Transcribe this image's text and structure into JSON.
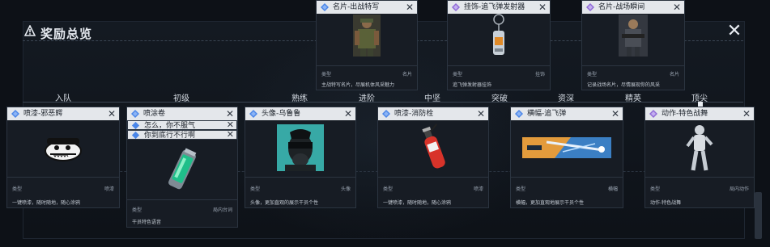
{
  "header": {
    "title": "奖励总览",
    "close_symbol": "✕"
  },
  "levels": [
    {
      "label": "入队"
    },
    {
      "label": "初级"
    },
    {
      "label": "熟练"
    },
    {
      "label": "进阶"
    },
    {
      "label": "中坚"
    },
    {
      "label": "突破"
    },
    {
      "label": "资深"
    },
    {
      "label": "精英"
    },
    {
      "label": "顶尖"
    }
  ],
  "top_cards": [
    {
      "title": "名片-出战特写",
      "type_label": "类型",
      "type_value": "名片",
      "desc": "主战特写名片，尽展机体风采魅力"
    },
    {
      "title": "挂饰-追飞弹发射器",
      "type_label": "类型",
      "type_value": "挂饰",
      "desc": "追飞弹发射器挂饰"
    },
    {
      "title": "名片-战场瞬间",
      "type_label": "类型",
      "type_value": "名片",
      "desc": "记录战场名片，尽情展现你的风采"
    }
  ],
  "bottom_cards": [
    {
      "title": "喷漆-邪恶鳄",
      "type_label": "类型",
      "type_value": "喷漆",
      "desc": "一键喷漆，随时随地，随心涂鸦"
    },
    {
      "title": "头像-乌鲁鲁",
      "type_label": "类型",
      "type_value": "头像",
      "desc": "头像，更加直观的展示干员个性"
    },
    {
      "title": "喷漆-消防栓",
      "type_label": "类型",
      "type_value": "喷漆",
      "desc": "一键喷漆，随时随地，随心涂鸦"
    },
    {
      "title": "横幅-追飞弹",
      "type_label": "类型",
      "type_value": "横幅",
      "desc": "横幅，更加直观地展示干员个性"
    },
    {
      "title": "动作-特色战舞",
      "type_label": "类型",
      "type_value": "局内动作",
      "desc": "动作-特色战舞"
    }
  ],
  "stacked_card": {
    "headers": [
      "喷涂卷",
      "怎么，你不服气",
      "你到底行不行啊"
    ],
    "type_label": "类型",
    "type_value": "局内台词",
    "desc": "干员特色语音"
  },
  "colors": {
    "accent_blue": "#4a86e8",
    "accent_purple": "#8f6bd6",
    "background": "#0d1117"
  }
}
